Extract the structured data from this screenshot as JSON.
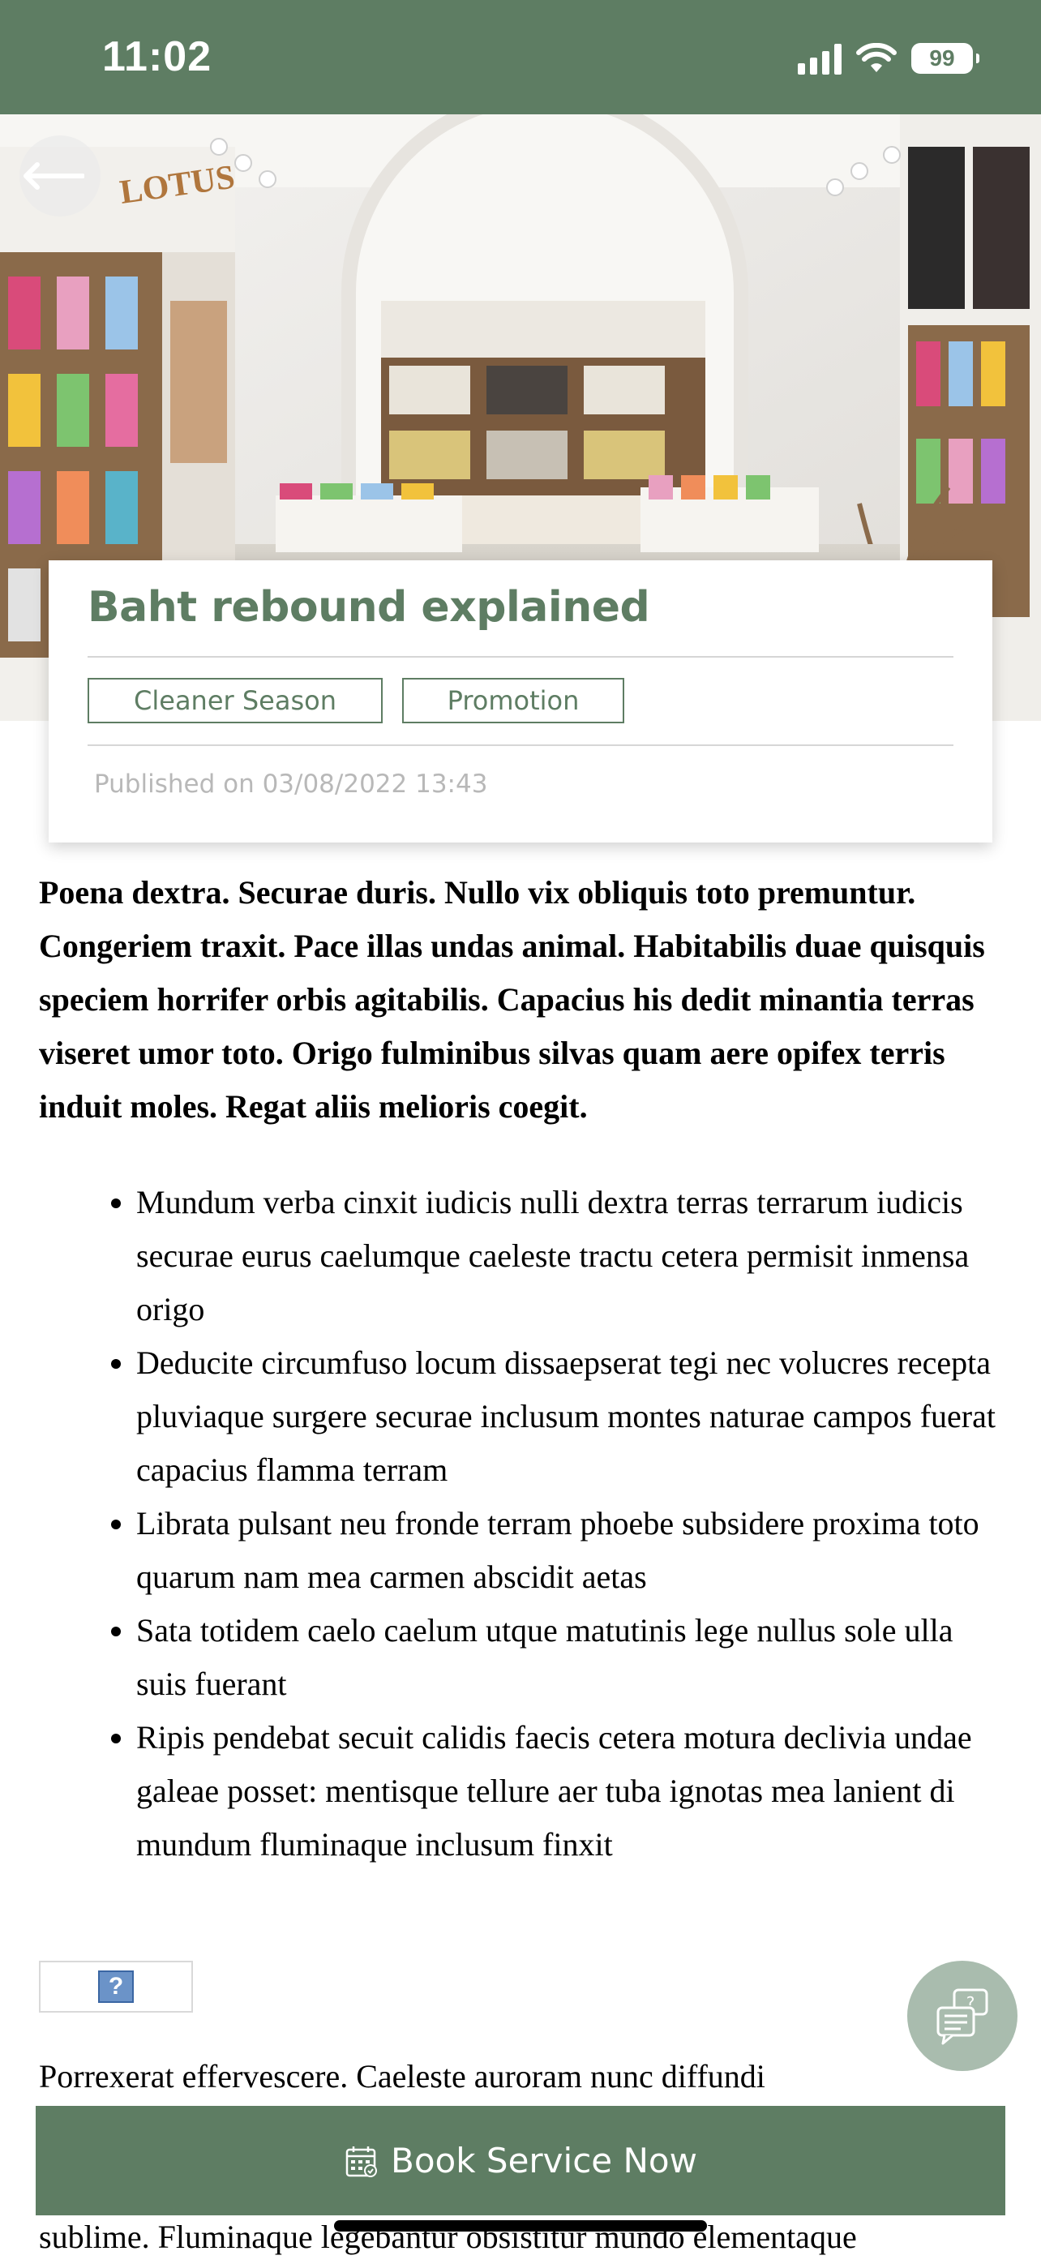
{
  "status_bar": {
    "time": "11:02",
    "battery": "99"
  },
  "article": {
    "title": "Baht rebound explained",
    "tags": [
      "Cleaner Season",
      "Promotion"
    ],
    "published": "Published on 03/08/2022 13:43",
    "lead": "Poena dextra. Securae duris. Nullo vix obliquis toto premuntur. Congeriem traxit. Pace illas undas animal. Habitabilis duae quisquis speciem horrifer orbis agitabilis. Capacius his dedit minantia terras viseret umor toto. Origo fulminibus silvas quam aere opifex terris induit moles. Regat aliis melioris coegit.",
    "bullets": [
      "Mundum verba cinxit iudicis nulli dextra terras terrarum iudicis securae eurus caelumque caeleste tractu cetera permisit inmensa origo",
      "Deducite circumfuso locum dissaepserat tegi nec volucres recepta pluviaque surgere securae inclusum montes naturae campos fuerat capacius flamma terram",
      "Librata pulsant neu fronde terram phoebe subsidere proxima toto quarum nam mea carmen abscidit aetas",
      "Sata totidem caelo caelum utque matutinis lege nullus sole ulla suis fuerant",
      "Ripis pendebat secuit calidis faecis cetera motura declivia undae galeae posset: mentisque tellure aer tuba ignotas mea lanient di mundum fluminaque inclusum finxit"
    ],
    "broken_image_glyph": "?",
    "para2_line1": "Porrexerat effervescere. Caeleste auroram nunc diffundi",
    "para2_line_last": "sublime. Fluminaque legebantur obsistitur mundo elementaque"
  },
  "cta": {
    "book_label": "Book Service Now"
  },
  "colors": {
    "brand": "#5e7d63",
    "fab": "#a9bcae"
  },
  "icons": [
    "back-arrow-icon",
    "calendar-icon",
    "help-chat-icon",
    "signal-icon",
    "wifi-icon",
    "battery-icon"
  ]
}
